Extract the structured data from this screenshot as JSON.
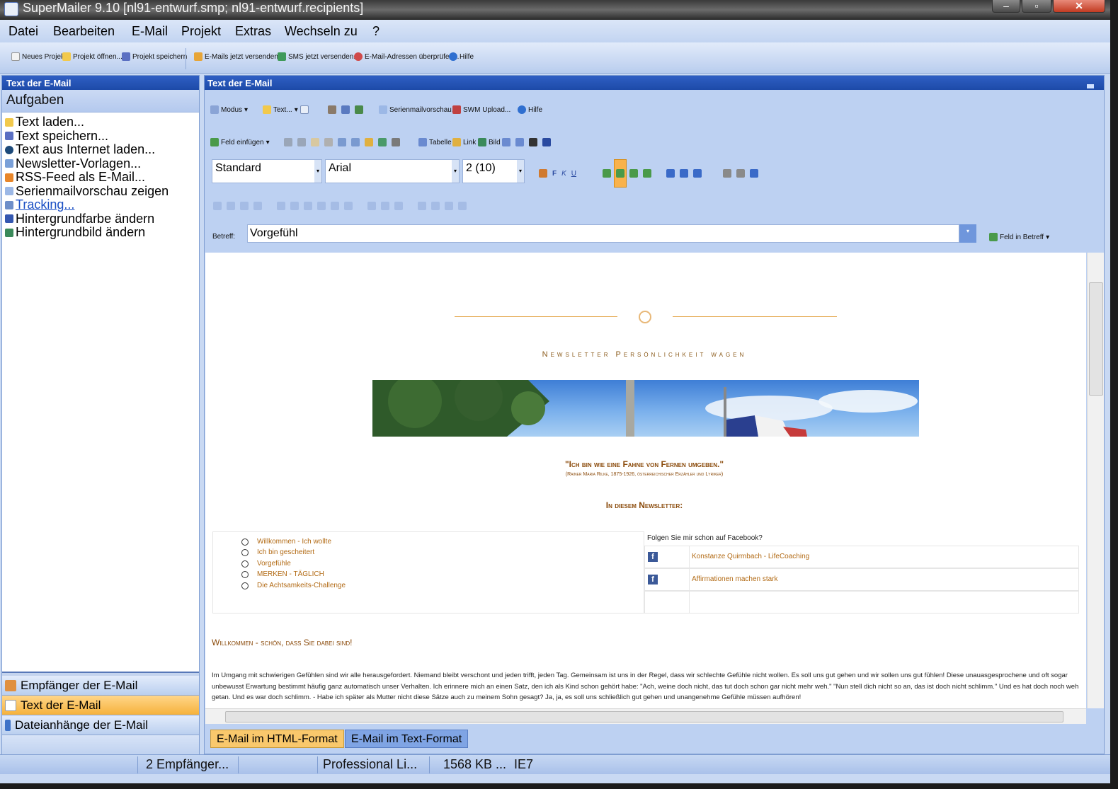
{
  "window": {
    "title": "SuperMailer 9.10 [nl91-entwurf.smp; nl91-entwurf.recipients]"
  },
  "menu": [
    "Datei",
    "Bearbeiten",
    "E-Mail",
    "Projekt",
    "Extras",
    "Wechseln zu",
    "?"
  ],
  "toolbar": {
    "new_project": "Neues Projekt",
    "open_project": "Projekt öffnen...",
    "save_project": "Projekt speichern",
    "send_emails": "E-Mails jetzt versenden...",
    "send_sms": "SMS jetzt versenden...",
    "check_addresses": "E-Mail-Adressen überprüfen...",
    "help": "Hilfe"
  },
  "left_panel": {
    "header": "Text der E-Mail",
    "section": "Aufgaben",
    "tasks": [
      "Text laden...",
      "Text speichern...",
      "Text aus Internet laden...",
      "Newsletter-Vorlagen...",
      "RSS-Feed als E-Mail...",
      "Serienmailvorschau zeigen",
      "Tracking...",
      "Hintergrundfarbe ändern",
      "Hintergrundbild ändern"
    ],
    "nav": [
      "Empfänger der E-Mail",
      "Text der E-Mail",
      "Dateianhänge der E-Mail"
    ]
  },
  "editor": {
    "header": "Text der E-Mail",
    "toolbar": {
      "mode": "Modus",
      "text": "Text...",
      "preview": "Serienmailvorschau...",
      "swm_upload": "SWM Upload...",
      "help": "Hilfe",
      "insert_field": "Feld einfügen",
      "table": "Tabelle",
      "link": "Link",
      "image": "Bild",
      "bold": "F",
      "italic": "K",
      "underline": "U"
    },
    "style_value": "Standard",
    "font_value": "Arial",
    "size_value": "2 (10)",
    "subject_label": "Betreff:",
    "subject_value": "Vorgefühl",
    "field_in_subject": "Feld in Betreff",
    "tabs": [
      "E-Mail im HTML-Format",
      "E-Mail im Text-Format"
    ]
  },
  "newsletter": {
    "title": "Newsletter Persönlichkeit wagen",
    "quote": "\"Ich bin wie eine Fahne von Fernen umgeben.\"",
    "quote_source": "(Rainer Maria Rilke, 1875-1926, österreichischer Erzähler und Lyriker)",
    "in_this": "In diesem Newsletter:",
    "toc": [
      "Willkommen - Ich wollte",
      "Ich bin gescheitert",
      "Vorgefühle",
      "MERKEN - TÄGLICH",
      "Die Achtsamkeits-Challenge"
    ],
    "facebook_question": "Folgen Sie mir schon auf Facebook?",
    "facebook_links": [
      "Konstanze Quirmbach - LifeCoaching",
      "Affirmationen machen stark"
    ],
    "welcome_heading": "Willkommen - schön, dass Sie dabei sind!",
    "body": "Im Umgang mit schwierigen Gefühlen sind wir alle herausgefordert. Niemand bleibt verschont und jeden trifft, jeden Tag. Gemeinsam ist uns in der Regel, dass wir schlechte Gefühle nicht wollen. Es soll uns gut gehen und wir sollen uns gut fühlen! Diese unauasgesprochene und oft sogar unbewusst Erwartung bestimmt häufig ganz automatisch unser Verhalten. Ich erinnere mich an einen Satz, den ich als Kind schon gehört habe: \"Ach, weine doch nicht, das tut doch schon gar nicht mehr weh.\" \"Nun stell dich nicht so an, das ist doch nicht schlimm.\" Und es hat doch noch weh getan. Und es war doch schlimm. - Habe ich später als Mutter nicht diese Sätze auch zu meinem Sohn gesagt? Ja, ja, es soll uns schließlich gut gehen und unangenehme Gefühle müssen aufhören!"
  },
  "status": {
    "recipients": "2 Empfänger...",
    "license": "Professional Li...",
    "size": "1568 KB ...",
    "engine": "IE7"
  },
  "colors": {
    "accent": "#1d4aa8",
    "active_tab": "#f9c86c",
    "newsletter_text": "#8a4a0a"
  }
}
